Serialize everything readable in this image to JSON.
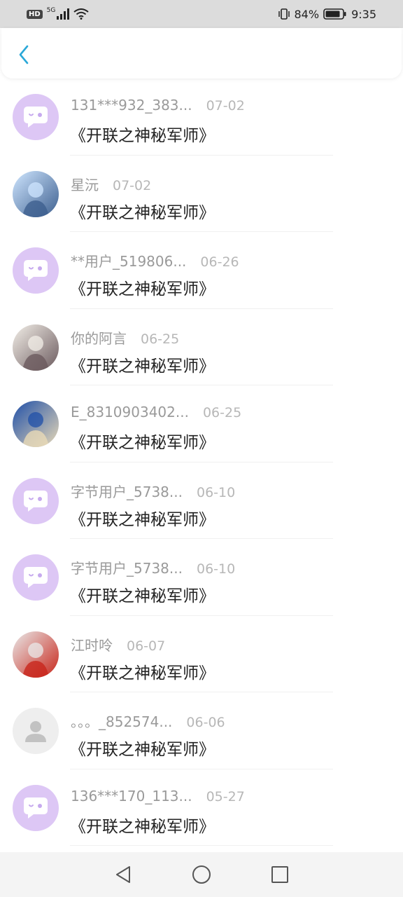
{
  "status_bar": {
    "network_badge": "HD",
    "signal_label": "5G",
    "battery_percent": "84%",
    "time": "9:35"
  },
  "header": {
    "back_icon": "chevron-left-icon",
    "accent_color": "#2aa8d8"
  },
  "items": [
    {
      "avatar_type": "default",
      "name": "131***932_383...",
      "date": "07-02",
      "title": "《开联之神秘军师》"
    },
    {
      "avatar_type": "photo",
      "avatar_colors": [
        "#cfe6ff",
        "#3d5f8f"
      ],
      "name": "星沅",
      "date": "07-02",
      "title": "《开联之神秘军师》"
    },
    {
      "avatar_type": "default",
      "name": "**用户_519806...",
      "date": "06-26",
      "title": "《开联之神秘军师》"
    },
    {
      "avatar_type": "photo",
      "avatar_colors": [
        "#f3efe8",
        "#6b5a5e"
      ],
      "name": "你的阿言",
      "date": "06-25",
      "title": "《开联之神秘军师》"
    },
    {
      "avatar_type": "photo",
      "avatar_colors": [
        "#1f4fa8",
        "#e8d9b7"
      ],
      "name": "E_8310903402...",
      "date": "06-25",
      "title": "《开联之神秘军师》"
    },
    {
      "avatar_type": "default",
      "name": "字节用户_5738...",
      "date": "06-10",
      "title": "《开联之神秘军师》"
    },
    {
      "avatar_type": "default",
      "name": "字节用户_5738...",
      "date": "06-10",
      "title": "《开联之神秘军师》"
    },
    {
      "avatar_type": "photo",
      "avatar_colors": [
        "#e9e9e9",
        "#c8261b"
      ],
      "name": "江时呤",
      "date": "06-07",
      "title": "《开联之神秘军师》"
    },
    {
      "avatar_type": "grey",
      "name": "。。。_852574...",
      "date": "06-06",
      "title": "《开联之神秘军师》"
    },
    {
      "avatar_type": "default",
      "name": "136***170_113...",
      "date": "05-27",
      "title": "《开联之神秘军师》"
    }
  ],
  "nav_bar": {
    "buttons": [
      "back-triangle-icon",
      "home-circle-icon",
      "recents-square-icon"
    ]
  }
}
